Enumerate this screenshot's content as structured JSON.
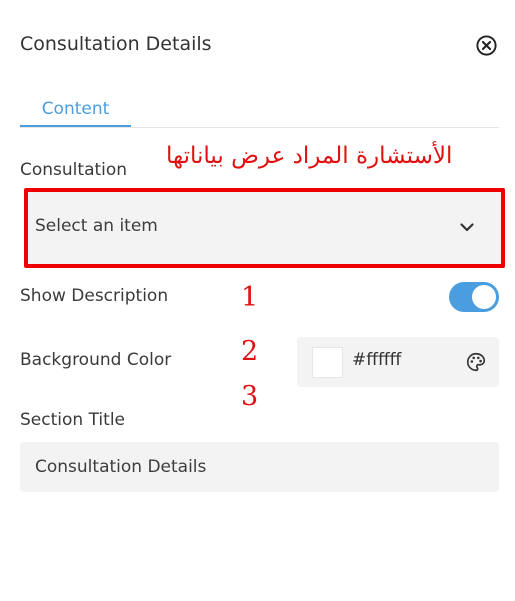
{
  "header": {
    "title": "Consultation Details",
    "close_icon": "close-circle-icon"
  },
  "tabs": [
    {
      "label": "Content",
      "active": true
    }
  ],
  "fields": {
    "consultation": {
      "label": "Consultation",
      "placeholder": "Select an item",
      "icon": "chevron-down-icon"
    },
    "show_description": {
      "label": "Show Description",
      "enabled": true
    },
    "background_color": {
      "label": "Background Color",
      "hash": "#",
      "value": "ffffff",
      "swatch": "#ffffff",
      "icon": "palette-icon"
    },
    "section_title": {
      "label": "Section Title",
      "value": "Consultation Details"
    }
  },
  "annotations": {
    "arabic_note": "الأستشارة المراد عرض بياناتها",
    "numbers": [
      "1",
      "2",
      "3"
    ],
    "color": "#ee0000"
  },
  "colors": {
    "accent": "#4a9ee0",
    "field_bg": "#f3f3f3"
  }
}
